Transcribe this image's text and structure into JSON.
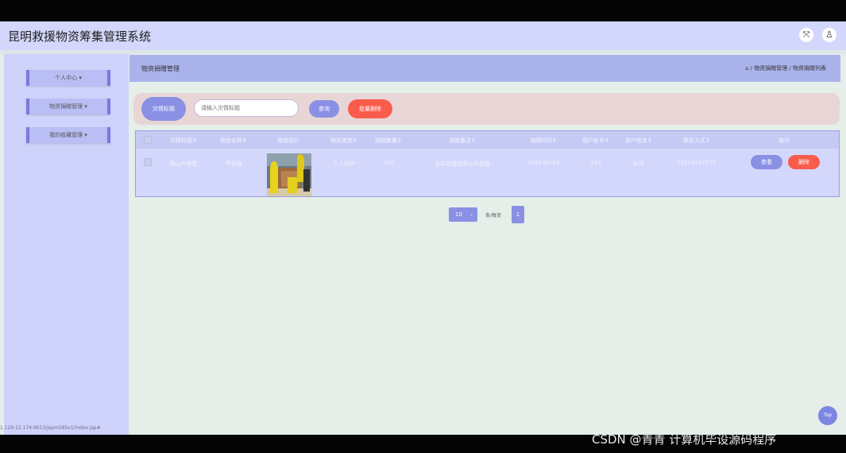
{
  "app": {
    "title": "昆明救援物资筹集管理系统"
  },
  "header": {
    "fullscreen_icon": "⤧",
    "user_icon": "♙"
  },
  "sidebar": {
    "items": [
      {
        "label": "个人中心 ▾"
      },
      {
        "label": "物资捐赠管理 ▾"
      },
      {
        "label": "我的收藏管理 ▾"
      }
    ],
    "status_url": "1.129.11.174:9013/jspm585v1/index.jsp#"
  },
  "page": {
    "title": "物资捐赠管理",
    "breadcrumb": "⌂ / 物资捐赠管理 / 物资捐赠列表"
  },
  "search": {
    "label": "灾情标题",
    "placeholder": "请输入灾情标题",
    "query_button": "查询",
    "batch_delete_button": "批量删除"
  },
  "table": {
    "columns": [
      "灾情标题⇕",
      "物资名称⇕",
      "物资图片",
      "物资类型⇕",
      "捐赠数量⇕",
      "捐赠备注⇕",
      "捐赠时间⇕",
      "用户账号⇕",
      "用户姓名⇕",
      "联系方式⇕",
      "操作"
    ],
    "rows": [
      {
        "title": "唐山大地震",
        "item_name": "呼吸器",
        "item_type": "个人防护",
        "quantity": "300",
        "remark": "支持救援给唐山大地震",
        "time": "2022-02-18",
        "account": "333",
        "name": "赵洋",
        "phone": "15219187575",
        "view_button": "查看",
        "delete_button": "删除"
      }
    ]
  },
  "pagination": {
    "page_size": "10",
    "per_page_label": "条/每页",
    "current_page": "1"
  },
  "top_button": "Top",
  "watermark": "CSDN @青青  计算机毕设源码程序",
  "colors": {
    "header_bg": "#d3d7fb",
    "sidebar_bg": "#cfd3fb",
    "primary": "#8a90e4",
    "danger": "#fa5c4c",
    "main_bg": "#e5eee9"
  }
}
